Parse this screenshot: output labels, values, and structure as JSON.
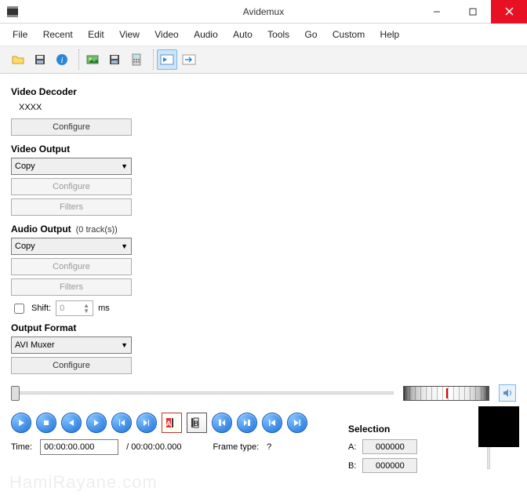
{
  "window": {
    "title": "Avidemux"
  },
  "menu": [
    "File",
    "Recent",
    "Edit",
    "View",
    "Video",
    "Audio",
    "Auto",
    "Tools",
    "Go",
    "Custom",
    "Help"
  ],
  "decoder": {
    "label": "Video Decoder",
    "value": "XXXX",
    "configure": "Configure"
  },
  "video_out": {
    "label": "Video Output",
    "mode": "Copy",
    "configure": "Configure",
    "filters": "Filters"
  },
  "audio_out": {
    "label": "Audio Output",
    "tracks": "(0 track(s))",
    "mode": "Copy",
    "configure": "Configure",
    "filters": "Filters",
    "shift_label": "Shift:",
    "shift_value": "0",
    "shift_unit": "ms"
  },
  "output_format": {
    "label": "Output Format",
    "mode": "AVI Muxer",
    "configure": "Configure"
  },
  "time": {
    "label": "Time:",
    "current": "00:00:00.000",
    "total": "/ 00:00:00.000",
    "frame_type_label": "Frame type:",
    "frame_type": "?"
  },
  "selection": {
    "label": "Selection",
    "a_label": "A:",
    "a_value": "000000",
    "b_label": "B:",
    "b_value": "000000"
  },
  "watermark": "HamiRayane.com"
}
